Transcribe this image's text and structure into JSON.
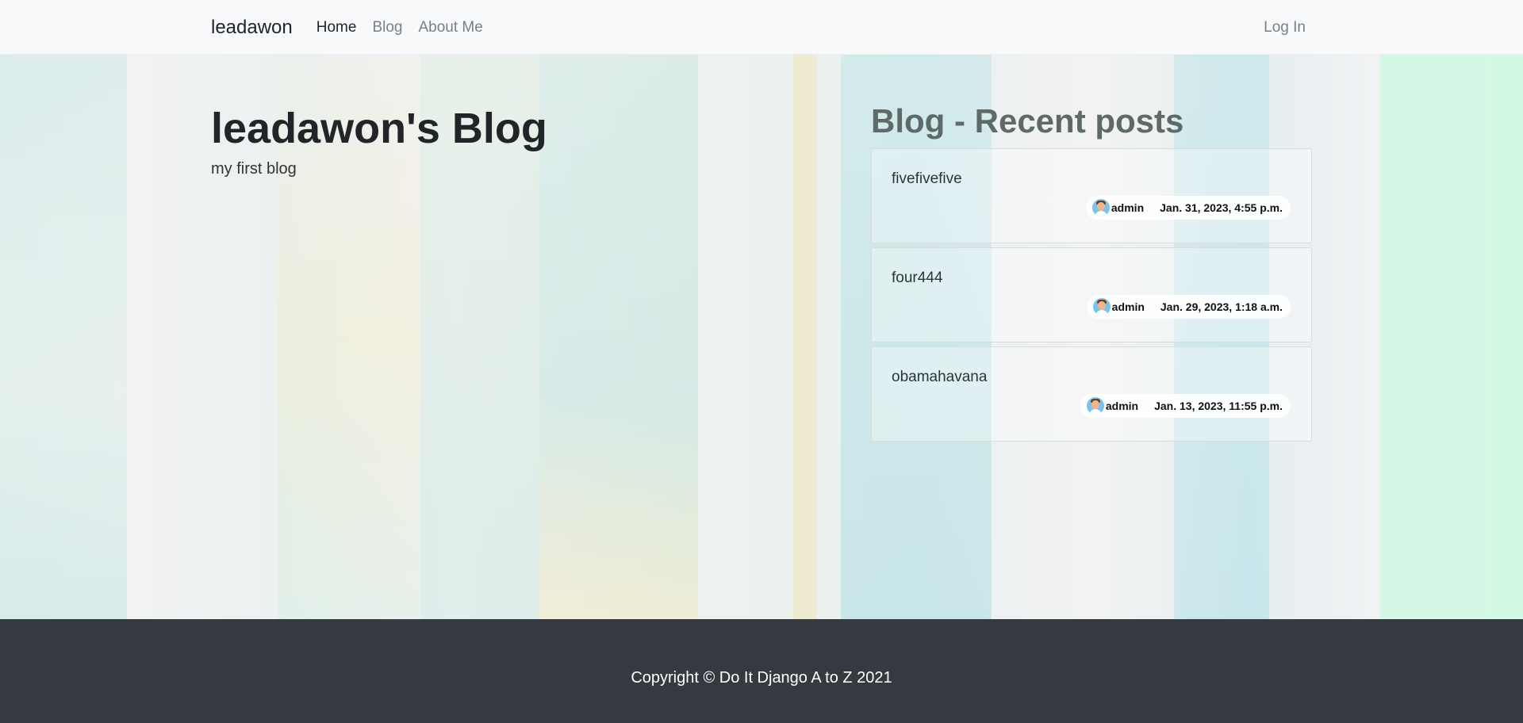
{
  "navbar": {
    "brand": "leadawon",
    "links": [
      {
        "label": "Home"
      },
      {
        "label": "Blog"
      },
      {
        "label": "About Me"
      }
    ],
    "login_label": "Log In"
  },
  "hero": {
    "title": "leadawon's Blog",
    "subtitle": "my first blog"
  },
  "recent": {
    "heading": "Blog - Recent posts",
    "posts": [
      {
        "title": "fivefivefive",
        "author": "admin",
        "date": "Jan. 31, 2023, 4:55 p.m."
      },
      {
        "title": "four444",
        "author": "admin",
        "date": "Jan. 29, 2023, 1:18 a.m."
      },
      {
        "title": "obamahavana",
        "author": "admin",
        "date": "Jan. 13, 2023, 11:55 p.m."
      }
    ]
  },
  "footer": {
    "copyright": "Copyright © Do It Django A to Z 2021"
  },
  "colors": {
    "navbar_bg": "#f8f9fa",
    "footer_bg": "#343a40",
    "heading_muted": "#5d6a68"
  }
}
